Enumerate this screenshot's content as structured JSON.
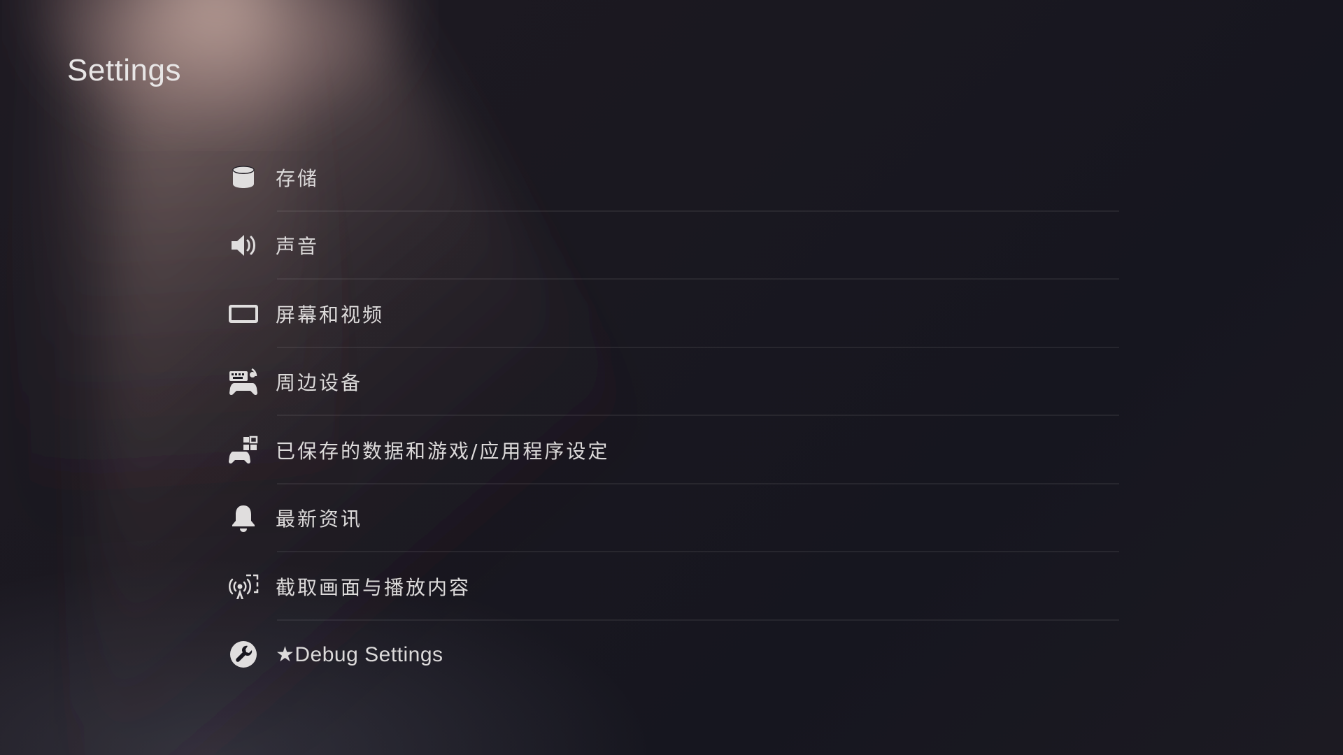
{
  "header": {
    "title": "Settings"
  },
  "menu": {
    "items": [
      {
        "label": "存储",
        "icon": "storage-icon"
      },
      {
        "label": "声音",
        "icon": "speaker-icon"
      },
      {
        "label": "屏幕和视频",
        "icon": "screen-icon"
      },
      {
        "label": "周边设备",
        "icon": "peripherals-icon"
      },
      {
        "label": "已保存的数据和游戏/应用程序设定",
        "icon": "saved-data-icon"
      },
      {
        "label": "最新资讯",
        "icon": "bell-icon"
      },
      {
        "label": "截取画面与播放内容",
        "icon": "capture-broadcast-icon"
      },
      {
        "label": "★Debug Settings",
        "icon": "wrench-icon"
      }
    ]
  },
  "colors": {
    "background": "#18171f",
    "text": "#dcdada",
    "icon": "#e0dede",
    "divider": "rgba(255,255,255,0.07)"
  }
}
